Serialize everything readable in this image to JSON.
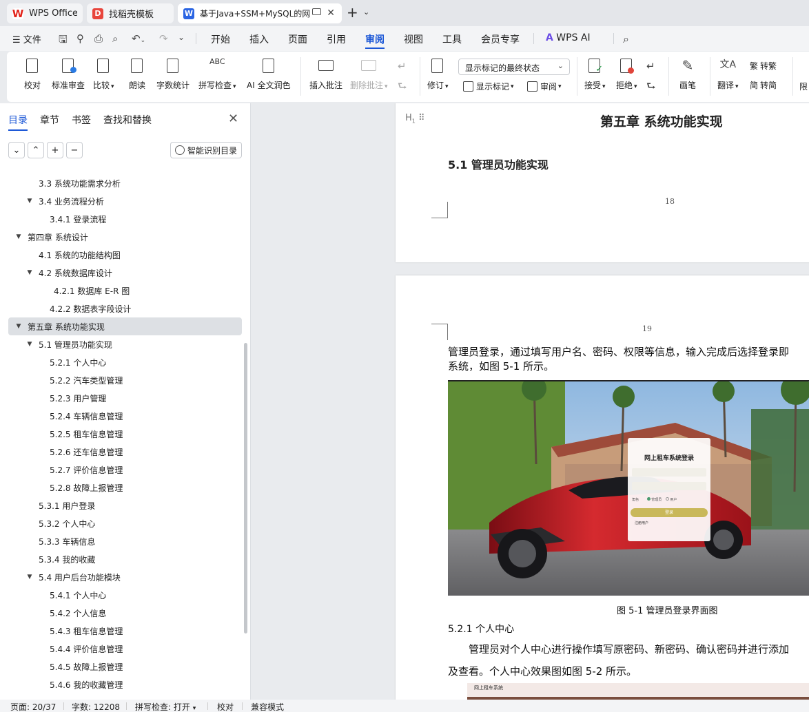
{
  "tabs": [
    {
      "label": "WPS Office",
      "icon": "wps-logo-icon",
      "color": "#e2231a"
    },
    {
      "label": "找稻壳模板",
      "icon": "docer-icon",
      "color": "#e8453c"
    },
    {
      "label": "基于Java+SSM+MySQL的网",
      "icon": "word-doc-icon",
      "color": "#2b65e3"
    }
  ],
  "menu": {
    "file": "文件",
    "items": [
      "开始",
      "插入",
      "页面",
      "引用",
      "审阅",
      "视图",
      "工具",
      "会员专享"
    ],
    "active": "审阅",
    "wps_ai": "WPS AI"
  },
  "ribbon": {
    "proofread": "校对",
    "standard_review": "标准审查",
    "compare": "比较",
    "read_aloud": "朗读",
    "word_count": "字数统计",
    "spell_check": "拼写检查",
    "ai_polish": "AI 全文润色",
    "insert_comment": "插入批注",
    "delete_comment": "删除批注",
    "track_changes": "修订",
    "markup_select": "显示标记的最终状态",
    "show_markup": "显示标记",
    "review": "审阅",
    "accept": "接受",
    "reject": "拒绝",
    "pen": "画笔",
    "translate": "翻译",
    "to_traditional": "转繁",
    "to_simplified": "转简",
    "limit": "限"
  },
  "nav": {
    "tabs": [
      "目录",
      "章节",
      "书签",
      "查找和替换"
    ],
    "active_tab": "目录",
    "smart_toc": "智能识别目录",
    "toc": [
      {
        "text": "3.3  系统功能需求分析",
        "level": 2,
        "expand": false
      },
      {
        "text": "3.4  业务流程分析",
        "level": 2,
        "expand": true
      },
      {
        "text": "3.4.1 登录流程",
        "level": 3,
        "expand": false
      },
      {
        "text": "第四章  系统设计",
        "level": 1,
        "expand": true
      },
      {
        "text": "4.1  系统的功能结构图",
        "level": 2,
        "expand": false
      },
      {
        "text": "4.2  系统数据库设计",
        "level": 2,
        "expand": true
      },
      {
        "text": "4.2.1    数据库 E-R 图",
        "level": 4,
        "expand": false
      },
      {
        "text": "4.2.2    数据表字段设计",
        "level": 3,
        "expand": false
      },
      {
        "text": "第五章  系统功能实现",
        "level": 1,
        "expand": true,
        "selected": true
      },
      {
        "text": "5.1 管理员功能实现",
        "level": 2,
        "expand": true
      },
      {
        "text": "5.2.1  个人中心",
        "level": 3,
        "expand": false
      },
      {
        "text": "5.2.2  汽车类型管理",
        "level": 3,
        "expand": false
      },
      {
        "text": "5.2.3 用户管理",
        "level": 3,
        "expand": false
      },
      {
        "text": "5.2.4  车辆信息管理",
        "level": 3,
        "expand": false
      },
      {
        "text": "5.2.5  租车信息管理",
        "level": 3,
        "expand": false
      },
      {
        "text": "5.2.6 还车信息管理",
        "level": 3,
        "expand": false
      },
      {
        "text": "5.2.7  评价信息管理",
        "level": 3,
        "expand": false
      },
      {
        "text": "5.2.8  故障上报管理",
        "level": 3,
        "expand": false
      },
      {
        "text": "5.3.1 用户登录",
        "level": 2,
        "expand": false
      },
      {
        "text": "5.3.2 个人中心",
        "level": 2,
        "expand": false
      },
      {
        "text": "5.3.3 车辆信息",
        "level": 2,
        "expand": false
      },
      {
        "text": "5.3.4 我的收藏",
        "level": 2,
        "expand": false
      },
      {
        "text": "5.4 用户后台功能模块",
        "level": 2,
        "expand": true
      },
      {
        "text": "5.4.1 个人中心",
        "level": 3,
        "expand": false
      },
      {
        "text": "5.4.2 个人信息",
        "level": 3,
        "expand": false
      },
      {
        "text": "5.4.3 租车信息管理",
        "level": 3,
        "expand": false
      },
      {
        "text": "5.4.4 评价信息管理",
        "level": 3,
        "expand": false
      },
      {
        "text": "5.4.5 故障上报管理",
        "level": 3,
        "expand": false
      },
      {
        "text": "5.4.6 我的收藏管理",
        "level": 3,
        "expand": false
      }
    ]
  },
  "doc": {
    "page1": {
      "chapter_title": "第五章  系统功能实现",
      "section_title": "5.1 管理员功能实现",
      "page_number": "18"
    },
    "page2": {
      "page_number": "19",
      "para1_line1": "管理员登录，通过填写用户名、密码、权限等信息，输入完成后选择登录即",
      "para1_line2": "系统，如图 5-1 所示。",
      "login_title": "网上租车系统登录",
      "login_role_label": "角色",
      "login_role_admin": "管理员",
      "login_role_user": "用户",
      "login_button": "登录",
      "login_register": "注册用户",
      "figure_caption": "图 5-1 管理员登录界面图",
      "subheading": "5.2.1  个人中心",
      "para2_line1": "管理员对个人中心进行操作填写原密码、新密码、确认密码并进行添加",
      "para2_line2": "及查看。个人中心效果图如图 5-2 所示。",
      "fig2_title": "网上租车系统"
    }
  },
  "status": {
    "page": "页面: 20/37",
    "words": "字数: 12208",
    "spell": "拼写检查: 打开",
    "proof": "校对",
    "compat": "兼容模式"
  }
}
